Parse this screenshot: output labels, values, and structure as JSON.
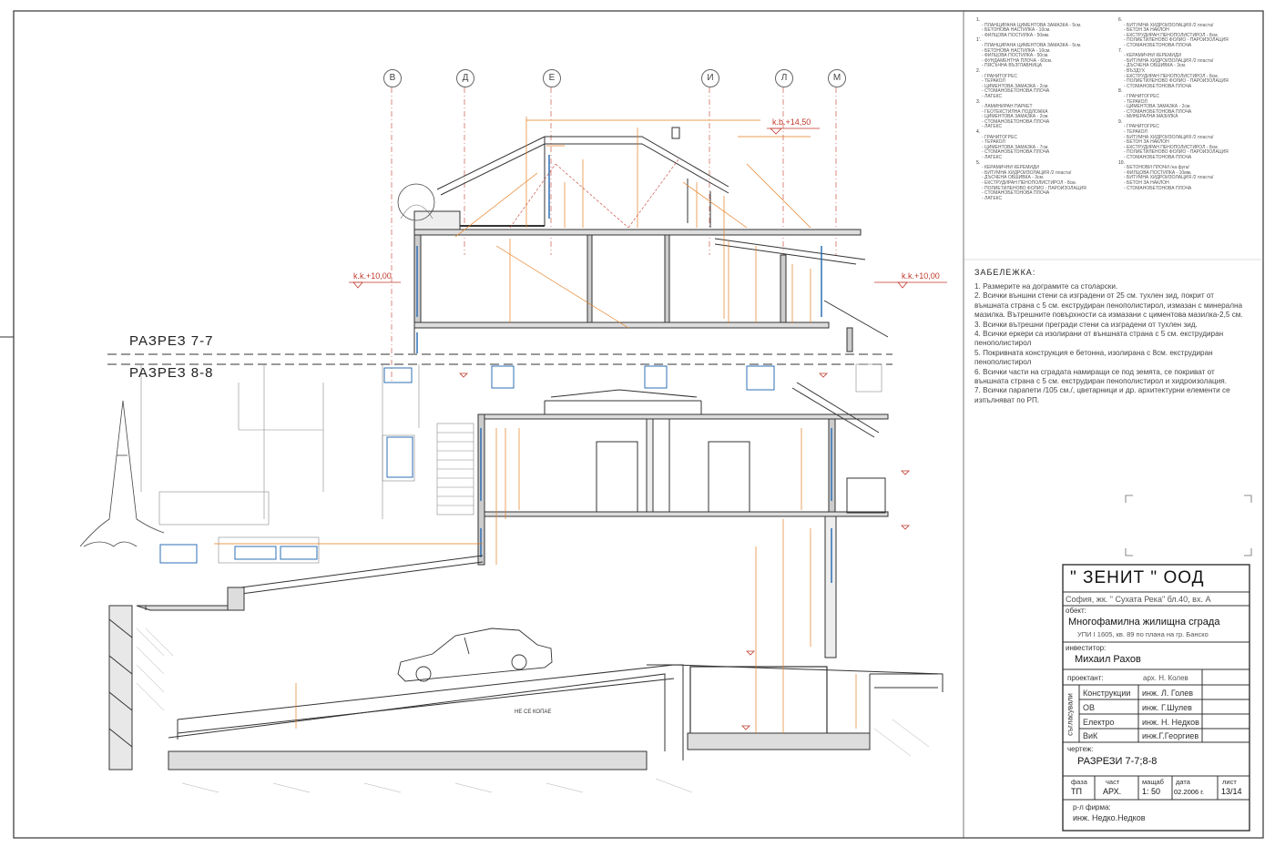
{
  "sections": {
    "upper": "РАЗРЕЗ 7-7",
    "lower": "РАЗРЕЗ 8-8"
  },
  "grid_axes": [
    "В",
    "Д",
    "Е",
    "И",
    "Л",
    "М"
  ],
  "elevations": {
    "roof_top": "k.b.+14,50",
    "left_level": "k.k.+10,00",
    "right_level": "k.k.+10,00"
  },
  "ground_note": "НЕ СЕ КОПАЕ",
  "layers": [
    {
      "n": "1.",
      "lines": [
        "- ПЛАНЦИРАНА ЦИМЕНТОВА ЗАМАЗКА - 5см.",
        "- БЕТОНОВА НАСТИЛКА - 10см.",
        "- ФИЛЦОВА ПОСТИЛКА - 50мм."
      ]
    },
    {
      "n": "1'.",
      "lines": [
        "- ПЛАНЦИРАНА ЦИМЕНТОВА ЗАМАЗКА - 5см.",
        "- БЕТОНОВА НАСТИЛКА - 10см.",
        "- ФИЛЦОВА ПОСТИЛКА - 50см.",
        "- ФУНДАМЕНТНА ПЛОЧА - 60см.",
        "- ПЯСЪЧНА ВЪЗГЛАВНИЦА"
      ]
    },
    {
      "n": "2.",
      "lines": [
        "- ГРАНИТОГРЕС",
        "- ТЕРАКОЛ",
        "- ЦИМЕНТОВА ЗАМАЗКА - 2см.",
        "- СТОМАНОБЕТОНОВА ПЛОЧА",
        "- ЛАТЕКС"
      ]
    },
    {
      "n": "3.",
      "lines": [
        "- ЛАМИНИРАН ПАРКЕТ",
        "- ГЕОТЕКСТИЛНА ПОДЛОЖКА",
        "- ЦИМЕНТОВА ЗАМАЗКА - 2см.",
        "- СТОМАНОБЕТОНОВА ПЛОЧА",
        "- ЛАТЕКС"
      ]
    },
    {
      "n": "4.",
      "lines": [
        "- ГРАНИТОГРЕС",
        "- ТЕРАКОЛ",
        "- ЦИМЕНТОВА ЗАМАЗКА - 7см.",
        "- СТОМАНОБЕТОНОВА ПЛОЧА",
        "- ЛАТЕКС"
      ]
    },
    {
      "n": "5.",
      "lines": [
        "- КЕРАМИЧНИ КЕРЕМИДИ",
        "- БИТУМНА ХИДРОИЗОЛАЦИЯ /2 пласта/",
        "- ДЪСЧЕНА ОБШИВКА - 3см.",
        "- ЕКСТРУДИРАН ПЕНОПОЛИСТИРОЛ - 8см.",
        "- ПОЛИЕТИЛЕНОВО ФОЛИО - ПАРОИЗОЛАЦИЯ",
        "- СТОМАНОБЕТОНОВА ПЛОЧА",
        "- ЛАТЕКС"
      ]
    }
  ],
  "layers_right": [
    {
      "n": "6.",
      "lines": [
        "- БИТУМНА ХИДРОИЗОЛАЦИЯ /2 пласта/",
        "- БЕТОН ЗА НАКЛОН",
        "- ЕКСТРУДИРАН ПЕНОПОЛИСТИРОЛ - 8см.",
        "- ПОЛИЕТИЛЕНОВО ФОЛИО - ПАРОИЗОЛАЦИЯ",
        "- СТОМАНОБЕТОНОВА ПЛОЧА"
      ]
    },
    {
      "n": "7.",
      "lines": [
        "- КЕРАМИЧНИ КЕРЕМИДИ",
        "- БИТУМНА ХИДРОИЗОЛАЦИЯ /2 пласта/",
        "- ДЪСЧЕНА ОБШИВКА - 3см.",
        "- ВЪЗДУХ",
        "- ЕКСТРУДИРАН ПЕНОПОЛИСТИРОЛ - 8см.",
        "- ПОЛИЕТИЛЕНОВО ФОЛИО - ПАРОИЗОЛАЦИЯ",
        "- СТОМАНОБЕТОНОВА ПЛОЧА"
      ]
    },
    {
      "n": "8.",
      "lines": [
        "- ГРАНИТОГРЕС",
        "- ТЕРАКОЛ",
        "- ЦИМЕНТОВА ЗАМАЗКА - 2см.",
        "- СТОМАНОБЕТОНОВА ПЛОЧА",
        "- МИНЕРАЛНА МАЗИЛКА"
      ]
    },
    {
      "n": "9.",
      "lines": [
        "- ГРАНИТОГРЕС",
        "- ТЕРАКОЛ",
        "- БИТУМНА ХИДРОИЗОЛАЦИЯ /2 пласта/",
        "- БЕТОН ЗА НАКЛОН",
        "- ЕКСТРУДИРАН ПЕНОПОЛИСТИРОЛ - 8см.",
        "- ПОЛИЕТИЛЕНОВО ФОЛИО - ПАРОИЗОЛАЦИЯ",
        "- СТОМАНОБЕТОНОВА ПЛОЧА"
      ]
    },
    {
      "n": "10.",
      "lines": [
        "- БЕТОНОВИ ПЛОЧИ /на фуга/",
        "- ФИЛЦОВА ПОСТИЛКА - 10мм.",
        "- БИТУМНА ХИДРОИЗОЛАЦИЯ /2 пласта/",
        "- БЕТОН ЗА НАКЛОН",
        "- СТОМАНОБЕТОНОВА ПЛОЧА"
      ]
    }
  ],
  "notes": {
    "title": "ЗАБЕЛЕЖКА:",
    "items": [
      "1. Размерите на дограмите са столарски.",
      "2. Всички външни стени са изградени от 25 см. тухлен зид, покрит от външната страна с 5 см. екструдиран пенополистирол, измазан с минерална мазилка. Вътрешните повърхности са измазани с циментова мазилка-2,5 см.",
      "3. Всички вътрешни прегради стени са изградени от тухлен зид.",
      "4. Всички еркери са изолирани от външната страна с 5 см. екструдиран пенополистирол",
      "5. Покривната конструкция е бетонна, изолирана с 8см. екструдиран пенополистирол",
      "6. Всички части на сградата намиращи се под земята, се покриват от външната страна с 5 см. екструдиран пенополистирол и хидроизолация.",
      "7. Всички парапети /105 см./, цветарници и др. архитектурни елементи се изпълняват по РП."
    ]
  },
  "title_block": {
    "company": "\" ЗЕНИТ \" ООД",
    "address": "София, жк. \" Сухата Река\" бл.40, вх. А",
    "object_label": "обект:",
    "object": "Многофамилна жилищна сграда",
    "object_sub": "УПИ I 1605, кв. 89 по плана на гр. Банско",
    "investor_label": "инвеститор:",
    "investor": "Михаил Рахов",
    "designer_label": "проектант:",
    "designer": "арх. Н. Колев",
    "coord_label": "съгласували",
    "coordination": [
      {
        "part": "Конструкции",
        "name": "инж. Л. Голев"
      },
      {
        "part": "ОВ",
        "name": "инж. Г.Шулев"
      },
      {
        "part": "Електро",
        "name": "инж. Н. Недков"
      },
      {
        "part": "ВиК",
        "name": "инж.Г.Георгиев"
      }
    ],
    "drawing_label": "чертеж:",
    "drawing": "РАЗРЕЗИ 7-7;8-8",
    "phase_label": "фаза",
    "phase": "ТП",
    "part_label": "част",
    "part": "АРХ.",
    "scale_label": "мащаб",
    "scale": "1: 50",
    "date_label": "дата",
    "date": "02.2006 г.",
    "sheet_label": "лист",
    "sheet": "13/14",
    "manager_label": "р-л фирма:",
    "manager": "инж. Недко.Недков"
  }
}
